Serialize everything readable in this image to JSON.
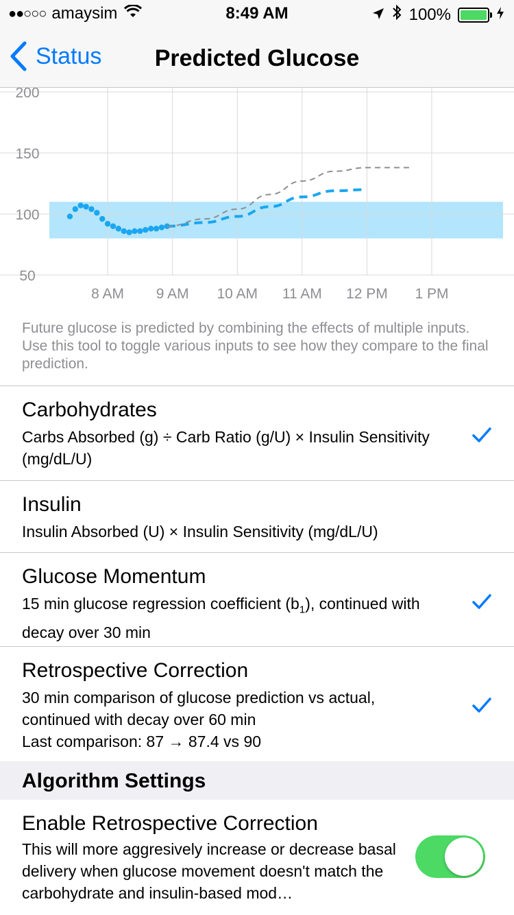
{
  "status_bar": {
    "signal_dots": "●●○○○",
    "carrier": "amaysim",
    "time": "8:49 AM",
    "battery": "100%"
  },
  "nav": {
    "back_label": "Status",
    "title": "Predicted Glucose"
  },
  "chart_data": {
    "type": "line",
    "y_ticks": [
      "200",
      "150",
      "100",
      "50"
    ],
    "x_ticks": [
      "8 AM",
      "9 AM",
      "10 AM",
      "11 AM",
      "12 PM",
      "1 PM"
    ],
    "ylim": [
      50,
      200
    ],
    "target_range": [
      80,
      110
    ],
    "grid": true,
    "series": [
      {
        "style": "dots",
        "color": "#1aa6f0",
        "x": [
          "7:25",
          "7:30",
          "7:35",
          "7:40",
          "7:45",
          "7:50",
          "7:55",
          "8:00",
          "8:05",
          "8:10",
          "8:15",
          "8:20",
          "8:25",
          "8:30",
          "8:35",
          "8:40",
          "8:45",
          "8:50",
          "8:55"
        ],
        "values": [
          98,
          104,
          107,
          106,
          104,
          101,
          96,
          92,
          90,
          88,
          86,
          85,
          86,
          86,
          87,
          88,
          88,
          89,
          90
        ]
      },
      {
        "style": "dashed-thick",
        "color": "#1aa6f0",
        "x": [
          "8:55",
          "9:30",
          "10:00",
          "10:30",
          "11:00",
          "11:30",
          "12:00"
        ],
        "values": [
          90,
          93,
          98,
          106,
          114,
          119,
          120
        ]
      },
      {
        "style": "dashed-thin",
        "color": "#8e8e93",
        "x": [
          "8:55",
          "9:30",
          "10:00",
          "10:30",
          "11:00",
          "11:30",
          "12:00",
          "12:40"
        ],
        "values": [
          90,
          96,
          104,
          116,
          127,
          135,
          138,
          138
        ]
      }
    ]
  },
  "footer_note": "Future glucose is predicted by combining the effects of multiple inputs. Use this tool to toggle various inputs to see how they compare to the final prediction.",
  "inputs": [
    {
      "title": "Carbohydrates",
      "description": "Carbs Absorbed (g) ÷ Carb Ratio (g/U) × Insulin Sensitivity (mg/dL/U)",
      "checked": true
    },
    {
      "title": "Insulin",
      "description": "Insulin Absorbed (U) × Insulin Sensitivity (mg/dL/U)",
      "checked": false
    },
    {
      "title": "Glucose Momentum",
      "description_pre": "15 min glucose regression coefficient (b",
      "description_sub": "1",
      "description_post": "), continued with decay over 30 min",
      "checked": true
    },
    {
      "title": "Retrospective Correction",
      "description": "30 min comparison of glucose prediction vs actual, continued with decay over 60 min",
      "description_extra": "Last comparison: 87 → 87.4 vs 90",
      "checked": true
    }
  ],
  "algorithm_settings": {
    "header": "Algorithm Settings",
    "retro_title": "Enable Retrospective Correction",
    "retro_description": "This will more aggresively increase or decrease basal delivery when glucose movement doesn't match the carbohydrate and insulin-based mod…",
    "toggle_on": true
  },
  "colors": {
    "accent": "#007aff",
    "glucose": "#1aa6f0",
    "target_band": "#b3e5fc",
    "toggle_on": "#4cd964"
  }
}
